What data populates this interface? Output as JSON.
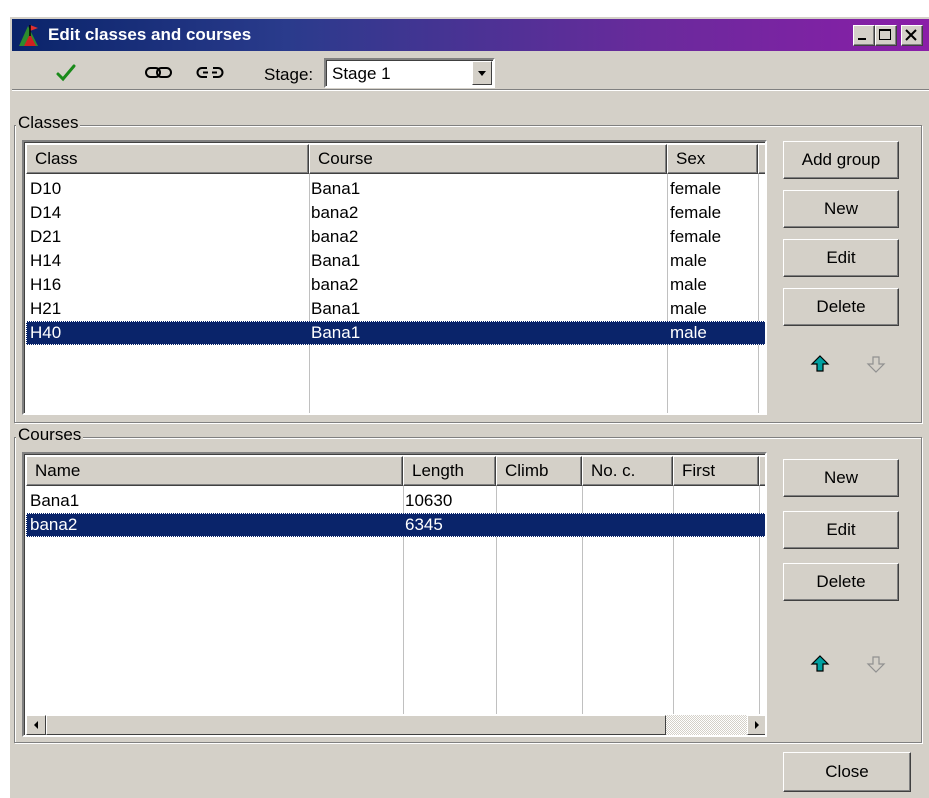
{
  "window": {
    "title": "Edit classes and courses",
    "title_colors": {
      "start": "#0a246a",
      "end": "#8a1ea8"
    }
  },
  "toolbar": {
    "icons": [
      "checkmark-icon",
      "link-icon",
      "unlink-icon"
    ],
    "stage_label": "Stage:",
    "stage_value": "Stage 1"
  },
  "classes": {
    "group_label": "Classes",
    "columns": [
      "Class",
      "Course",
      "Sex"
    ],
    "rows": [
      {
        "class": "D10",
        "course": "Bana1",
        "sex": "female"
      },
      {
        "class": "D14",
        "course": "bana2",
        "sex": "female"
      },
      {
        "class": "D21",
        "course": "bana2",
        "sex": "female"
      },
      {
        "class": "H14",
        "course": "Bana1",
        "sex": "male"
      },
      {
        "class": "H16",
        "course": "bana2",
        "sex": "male"
      },
      {
        "class": "H21",
        "course": "Bana1",
        "sex": "male"
      },
      {
        "class": "H40",
        "course": "Bana1",
        "sex": "male"
      }
    ],
    "selected_index": 6,
    "buttons": {
      "add_group": "Add group",
      "new": "New",
      "edit": "Edit",
      "delete": "Delete"
    }
  },
  "courses": {
    "group_label": "Courses",
    "columns": [
      "Name",
      "Length",
      "Climb",
      "No. c.",
      "First"
    ],
    "rows": [
      {
        "name": "Bana1",
        "length": "10630",
        "climb": "",
        "no_c": "",
        "first": ""
      },
      {
        "name": "bana2",
        "length": "6345",
        "climb": "",
        "no_c": "",
        "first": ""
      }
    ],
    "selected_index": 1,
    "buttons": {
      "new": "New",
      "edit": "Edit",
      "delete": "Delete"
    }
  },
  "footer": {
    "close_label": "Close"
  },
  "colors": {
    "selection": "#0a246a",
    "face": "#d4d0c8",
    "up_arrow": "#00a0a0"
  }
}
